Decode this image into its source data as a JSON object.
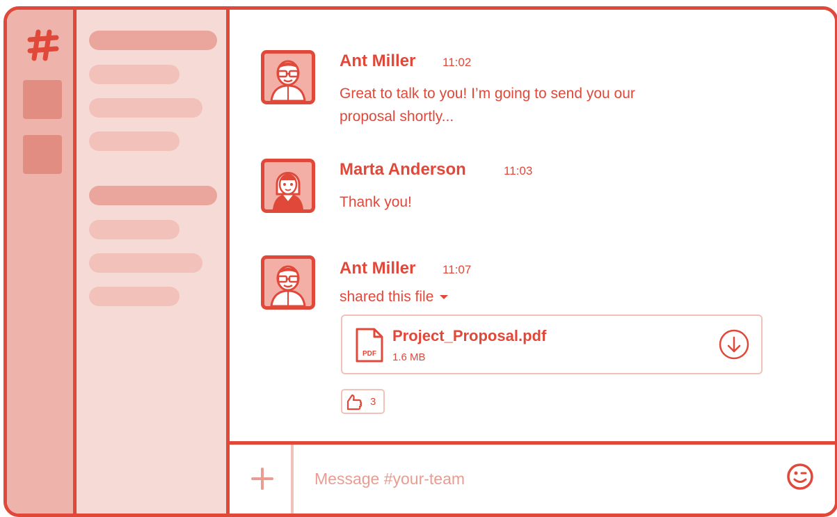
{
  "colors": {
    "accent": "#e0483a",
    "rail": "#eeb4ac",
    "channels_bg": "#f6dad6"
  },
  "messages": [
    {
      "author": "Ant Miller",
      "time": "11:02",
      "lines": [
        "Great to talk to you! I’m going to send you our",
        "proposal shortly..."
      ]
    },
    {
      "author": "Marta Anderson",
      "time": "11:03",
      "lines": [
        "Thank you!"
      ]
    },
    {
      "author": "Ant Miller",
      "time": "11:07",
      "subtitle": "shared this file"
    }
  ],
  "file": {
    "name": "Project_Proposal.pdf",
    "size": "1.6 MB",
    "type_label": "PDF"
  },
  "reaction": {
    "icon": "thumbs-up-icon",
    "count": "3"
  },
  "composer": {
    "placeholder": "Message #your-team"
  }
}
